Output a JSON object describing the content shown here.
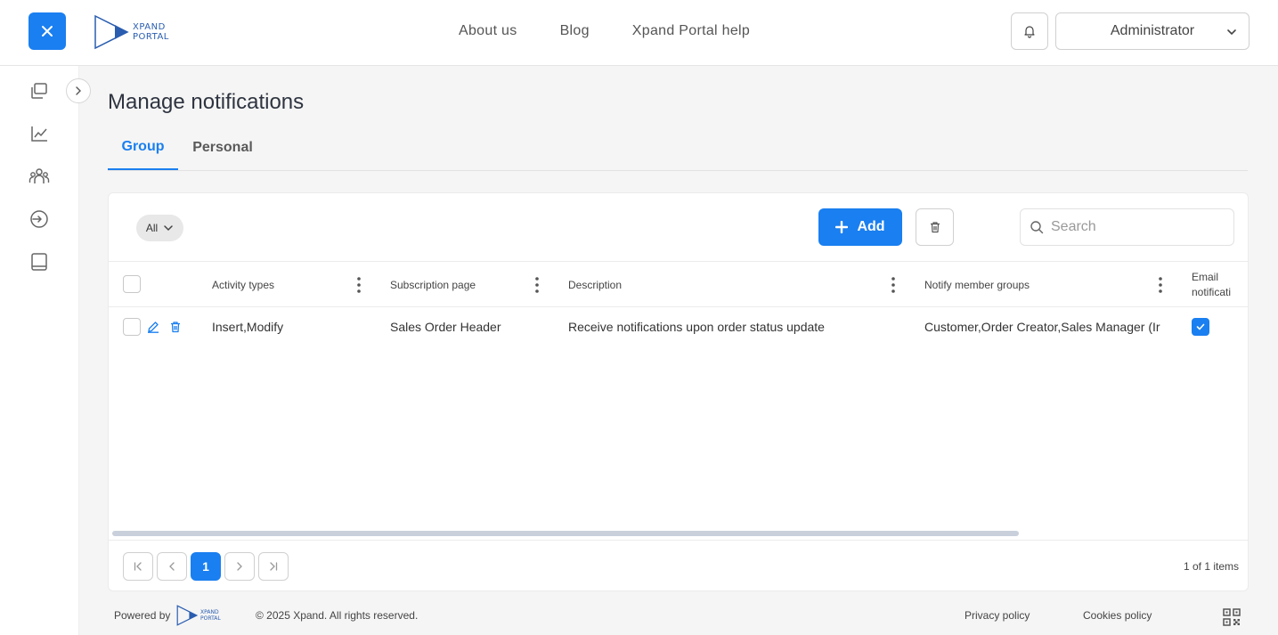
{
  "header": {
    "logo_line1": "XPAND",
    "logo_line2": "PORTAL",
    "nav": [
      "About us",
      "Blog",
      "Xpand Portal help"
    ],
    "user": "Administrator"
  },
  "page": {
    "title": "Manage notifications",
    "tabs": [
      {
        "label": "Group",
        "active": true
      },
      {
        "label": "Personal",
        "active": false
      }
    ]
  },
  "toolbar": {
    "filter_label": "All",
    "add_label": "Add",
    "search_placeholder": "Search"
  },
  "table": {
    "columns": [
      "Activity types",
      "Subscription page",
      "Description",
      "Notify member groups",
      "Email notifications"
    ],
    "email_header_visible": [
      "Email",
      "notificati"
    ],
    "rows": [
      {
        "activity_types": "Insert,Modify",
        "subscription_page": "Sales Order Header",
        "description": "Receive notifications upon order status update",
        "notify_member_groups": "Customer,Order Creator,Sales Manager (Ir",
        "email_notifications": true
      }
    ]
  },
  "pagination": {
    "current_page": "1",
    "items_summary": "1 of 1 items"
  },
  "footer": {
    "powered_by": "Powered by",
    "logo_line1": "XPAND",
    "logo_line2": "PORTAL",
    "copyright": "© 2025 Xpand. All rights reserved.",
    "privacy": "Privacy policy",
    "cookies": "Cookies policy"
  },
  "colors": {
    "accent": "#1a7ff0",
    "logo": "#2a5db0"
  },
  "icons": {
    "close": "close-icon",
    "bell": "bell-icon",
    "chevron": "chevron-down-icon",
    "sidebar": [
      "folders-icon",
      "chart-line-icon",
      "users-icon",
      "sign-in-icon",
      "book-icon"
    ],
    "qr": "qr-code-icon"
  }
}
